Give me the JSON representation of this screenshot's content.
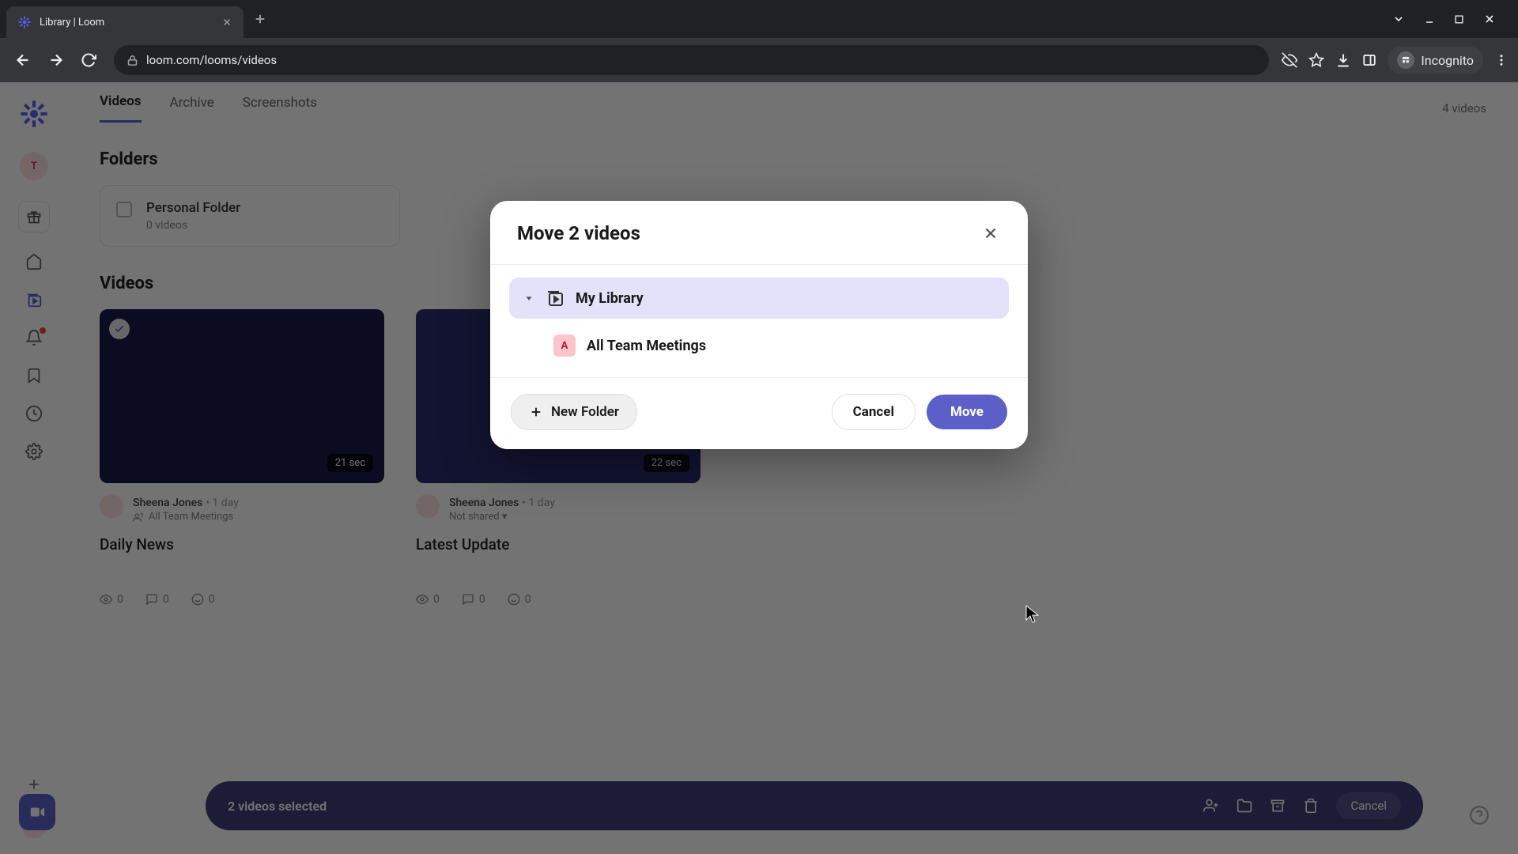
{
  "browser": {
    "tab_title": "Library | Loom",
    "url": "loom.com/looms/videos",
    "incognito_label": "Incognito"
  },
  "app": {
    "tabs": {
      "videos": "Videos",
      "archive": "Archive",
      "screenshots": "Screenshots"
    },
    "video_count": "4 videos",
    "sections": {
      "folders": "Folders",
      "videos": "Videos"
    },
    "folder": {
      "name": "Personal Folder",
      "count": "0 videos"
    },
    "sidebar": {
      "avatar_letter": "T",
      "team_letter": "A"
    },
    "video_cards": [
      {
        "author": "Sheena Jones",
        "time": "• 1 day",
        "share": "All Team Meetings",
        "title": "Daily News",
        "duration": "21 sec",
        "views": "0",
        "comments": "0",
        "reactions": "0"
      },
      {
        "author": "Sheena Jones",
        "time": "• 1 day",
        "share": "Not shared ▾",
        "title": "Latest Update",
        "duration": "22 sec",
        "views": "0",
        "comments": "0",
        "reactions": "0"
      }
    ],
    "selection_bar": {
      "text": "2 videos selected",
      "cancel": "Cancel"
    }
  },
  "modal": {
    "title": "Move 2 videos",
    "my_library": "My Library",
    "sub_folder_letter": "A",
    "sub_folder": "All Team Meetings",
    "new_folder": "New Folder",
    "cancel": "Cancel",
    "move": "Move"
  }
}
